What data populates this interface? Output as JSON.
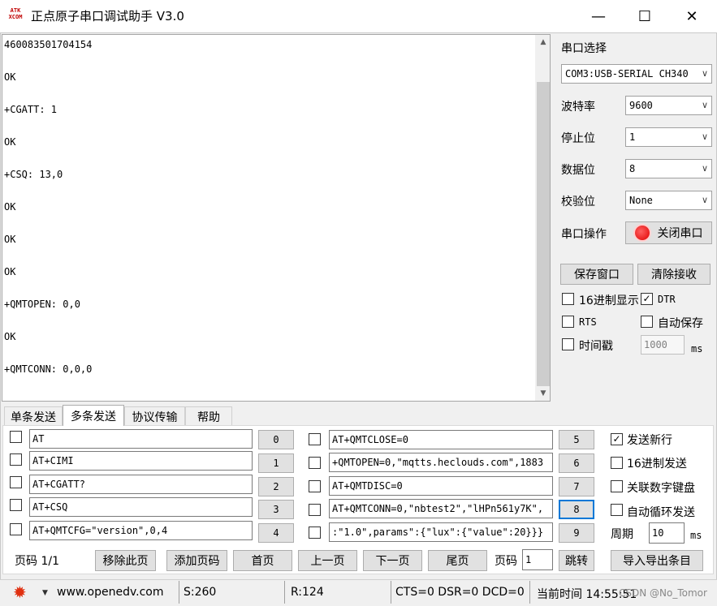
{
  "window": {
    "logo_text_top": "ATK",
    "logo_text_bottom": "XCOM",
    "title": "正点原子串口调试助手 V3.0",
    "minimize_glyph": "—",
    "maximize_glyph": "☐",
    "close_glyph": "✕"
  },
  "receive": {
    "text": "460083501704154\n\nOK\n\n+CGATT: 1\n\nOK\n\n+CSQ: 13,0\n\nOK\n\nOK\n\nOK\n\n+QMTOPEN: 0,0\n\nOK\n\n+QMTCONN: 0,0,0",
    "scroll_up_glyph": "▲",
    "scroll_down_glyph": "▼"
  },
  "serial": {
    "port_select_label": "串口选择",
    "port_value": "COM3:USB-SERIAL CH340",
    "baud_label": "波特率",
    "baud_value": "9600",
    "stop_bits_label": "停止位",
    "stop_bits_value": "1",
    "data_bits_label": "数据位",
    "data_bits_value": "8",
    "parity_label": "校验位",
    "parity_value": "None",
    "port_op_label": "串口操作",
    "close_port_label": "关闭串口",
    "save_window_label": "保存窗口",
    "clear_receive_label": "清除接收",
    "hex_display_label": "16进制显示",
    "hex_display_checked": false,
    "dtr_label": "DTR",
    "dtr_checked": true,
    "rts_label": "RTS",
    "rts_checked": false,
    "auto_save_label": "自动保存",
    "auto_save_checked": false,
    "timestamp_label": "时间戳",
    "timestamp_checked": false,
    "timestamp_value": "1000",
    "timestamp_unit": "ms",
    "dropdown_glyph": "∨"
  },
  "tabs": [
    {
      "label": "单条发送",
      "active": false
    },
    {
      "label": "多条发送",
      "active": true
    },
    {
      "label": "协议传输",
      "active": false
    },
    {
      "label": "帮助",
      "active": false
    }
  ],
  "multi_send": {
    "left_rows": [
      {
        "command": "AT",
        "button": "0"
      },
      {
        "command": "AT+CIMI",
        "button": "1"
      },
      {
        "command": "AT+CGATT?",
        "button": "2"
      },
      {
        "command": "AT+CSQ",
        "button": "3"
      },
      {
        "command": "AT+QMTCFG=\"version\",0,4",
        "button": "4"
      }
    ],
    "right_rows": [
      {
        "command": "AT+QMTCLOSE=0",
        "button": "5"
      },
      {
        "command": "+QMTOPEN=0,\"mqtts.heclouds.com\",1883",
        "button": "6"
      },
      {
        "command": "AT+QMTDISC=0",
        "button": "7"
      },
      {
        "command": "AT+QMTCONN=0,\"nbtest2\",\"lHPn561y7K\",",
        "button": "8"
      },
      {
        "command": ":\"1.0\",params\":{\"lux\":{\"value\":20}}}",
        "button": "9"
      }
    ],
    "send_newline_label": "发送新行",
    "send_newline_checked": true,
    "hex_send_label": "16进制发送",
    "hex_send_checked": false,
    "link_keypad_label": "关联数字键盘",
    "link_keypad_checked": false,
    "auto_loop_label": "自动循环发送",
    "auto_loop_checked": false,
    "period_label": "周期",
    "period_value": "10",
    "period_unit": "ms"
  },
  "pager": {
    "page_label": "页码 1/1",
    "remove_page": "移除此页",
    "add_page": "添加页码",
    "first_page": "首页",
    "prev_page": "上一页",
    "next_page": "下一页",
    "last_page": "尾页",
    "goto_label": "页码",
    "goto_value": "1",
    "jump": "跳转",
    "import_export": "导入导出条目"
  },
  "status": {
    "website": "www.openedv.com",
    "sent": "S:260",
    "received": "R:124",
    "lines": "CTS=0 DSR=0 DCD=0",
    "time": "当前时间 14:55:51",
    "watermark": "CSDN @No_Tomor"
  }
}
